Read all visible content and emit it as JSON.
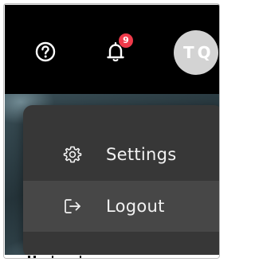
{
  "header": {
    "help_icon": "question-circle-icon",
    "notifications": {
      "icon": "bell-icon",
      "count": "9"
    },
    "user": {
      "initials": "TQ"
    }
  },
  "dropdown": {
    "items": [
      {
        "icon": "gear-icon",
        "label": "Settings"
      },
      {
        "icon": "logout-icon",
        "label": "Logout"
      }
    ]
  },
  "colors": {
    "topbar_bg": "#000000",
    "badge_bg": "#ef3a4a",
    "avatar_bg": "#d3d3d3",
    "menu_bg": "#373737",
    "menu_hover_bg": "#474747",
    "menu_text": "#f2f2f2"
  }
}
